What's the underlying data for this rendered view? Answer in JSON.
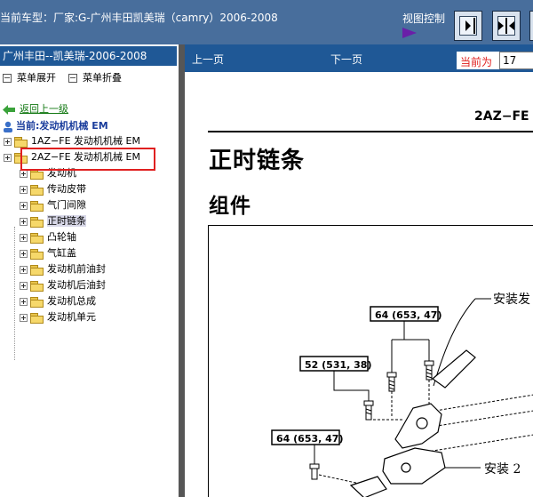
{
  "top_bar": {
    "vehicle_text": "当前车型：厂家:G-广州丰田凯美瑞（camry）2006-2008",
    "view_control_label": "视图控制",
    "view_buttons": [
      "single-pane-right-icon",
      "split-both-icon",
      "single-pane-left-icon"
    ]
  },
  "left_panel": {
    "title": "广州丰田--凯美瑞-2006-2008",
    "expand_label": "菜单展开",
    "collapse_label": "菜单折叠",
    "back_label": "返回上一级",
    "current_label": "当前:发动机机械 EM",
    "tree": [
      {
        "label": "1AZ−FE 发动机机械 EM",
        "level": 1
      },
      {
        "label": "2AZ−FE 发动机机械 EM",
        "level": 1,
        "highlighted": true
      },
      {
        "label": "发动机",
        "level": 2
      },
      {
        "label": "传动皮带",
        "level": 2
      },
      {
        "label": "气门间隙",
        "level": 2
      },
      {
        "label": "正时链条",
        "level": 2,
        "selected": true
      },
      {
        "label": "凸轮轴",
        "level": 2
      },
      {
        "label": "气缸盖",
        "level": 2
      },
      {
        "label": "发动机前油封",
        "level": 2
      },
      {
        "label": "发动机后油封",
        "level": 2
      },
      {
        "label": "发动机总成",
        "level": 2
      },
      {
        "label": "发动机单元",
        "level": 2
      }
    ]
  },
  "nav": {
    "prev_label": "上一页",
    "next_label": "下一页",
    "current_page_label": "当前为",
    "current_page_value": "17"
  },
  "document": {
    "code": "2AZ−FE",
    "title": "正时链条",
    "subtitle": "组件",
    "figure": {
      "torque_1": "64 (653, 47)",
      "torque_2": "52 (531, 38)",
      "torque_3": "64 (653, 47)",
      "callout_1": "安装发",
      "callout_2": "安装 2"
    }
  },
  "colors": {
    "top_bar": "#486e9c",
    "panel_title": "#1f5896",
    "splitter": "#565656",
    "highlight_box": "#e02020",
    "page_label": "#e02020"
  }
}
